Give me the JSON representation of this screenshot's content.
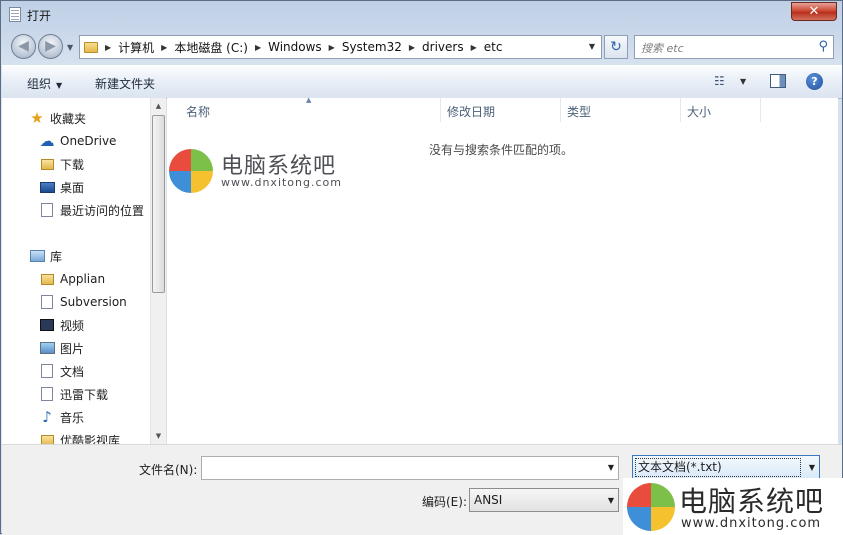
{
  "window": {
    "title": "打开",
    "close_label": "✕"
  },
  "nav": {
    "back_label": "◀",
    "forward_label": "▶",
    "history_label": "▼",
    "breadcrumbs": [
      "计算机",
      "本地磁盘 (C:)",
      "Windows",
      "System32",
      "drivers",
      "etc"
    ],
    "separator": "▶",
    "address_drop": "▼",
    "refresh_label": "↻",
    "search_placeholder": "搜索 etc",
    "search_icon": "⚲"
  },
  "toolbar": {
    "organize_label": "组织",
    "organize_arrow": "▼",
    "new_folder_label": "新建文件夹",
    "view_icon": "☷",
    "view_arrow": "▼",
    "help_label": "?"
  },
  "sidebar": {
    "items": [
      {
        "label": "收藏夹",
        "icon": "star-icon",
        "glyph": "★"
      },
      {
        "label": "OneDrive",
        "icon": "cloud-icon",
        "glyph": "☁"
      },
      {
        "label": "下载",
        "icon": "folder-icon",
        "glyph": ""
      },
      {
        "label": "桌面",
        "icon": "desktop-icon",
        "glyph": ""
      },
      {
        "label": "最近访问的位置",
        "icon": "recent-icon",
        "glyph": ""
      },
      {
        "label": "库",
        "icon": "library-icon",
        "glyph": ""
      },
      {
        "label": "Applian",
        "icon": "folder-icon",
        "glyph": ""
      },
      {
        "label": "Subversion",
        "icon": "document-icon",
        "glyph": ""
      },
      {
        "label": "视频",
        "icon": "video-icon",
        "glyph": ""
      },
      {
        "label": "图片",
        "icon": "picture-icon",
        "glyph": ""
      },
      {
        "label": "文档",
        "icon": "document-icon",
        "glyph": ""
      },
      {
        "label": "迅雷下载",
        "icon": "document-icon",
        "glyph": ""
      },
      {
        "label": "音乐",
        "icon": "music-icon",
        "glyph": "♪"
      },
      {
        "label": "优酷影视库",
        "icon": "folder-icon",
        "glyph": ""
      }
    ]
  },
  "scrollbar": {
    "up": "▲",
    "down": "▼"
  },
  "file_list": {
    "columns": [
      "名称",
      "修改日期",
      "类型",
      "大小"
    ],
    "sort_indicator": "▲",
    "empty_message": "没有与搜索条件匹配的项。"
  },
  "watermark": {
    "title": "电脑系统吧",
    "url": "www.dnxitong.com",
    "colors": [
      "#e94b3c",
      "#7cc04a",
      "#3f8fd8",
      "#f5c12e"
    ]
  },
  "bottom": {
    "filename_label": "文件名(N):",
    "filename_value": "",
    "filename_drop": "▼",
    "filetype_value": "文本文档(*.txt)",
    "filetype_drop": "▼",
    "encoding_label": "编码(E):",
    "encoding_value": "ANSI",
    "encoding_drop": "▼"
  },
  "colors": {
    "accent": "#3b78c4",
    "title_bar": "#bfd0e6",
    "close": "#cc4a35",
    "header_text": "#4c607a"
  }
}
